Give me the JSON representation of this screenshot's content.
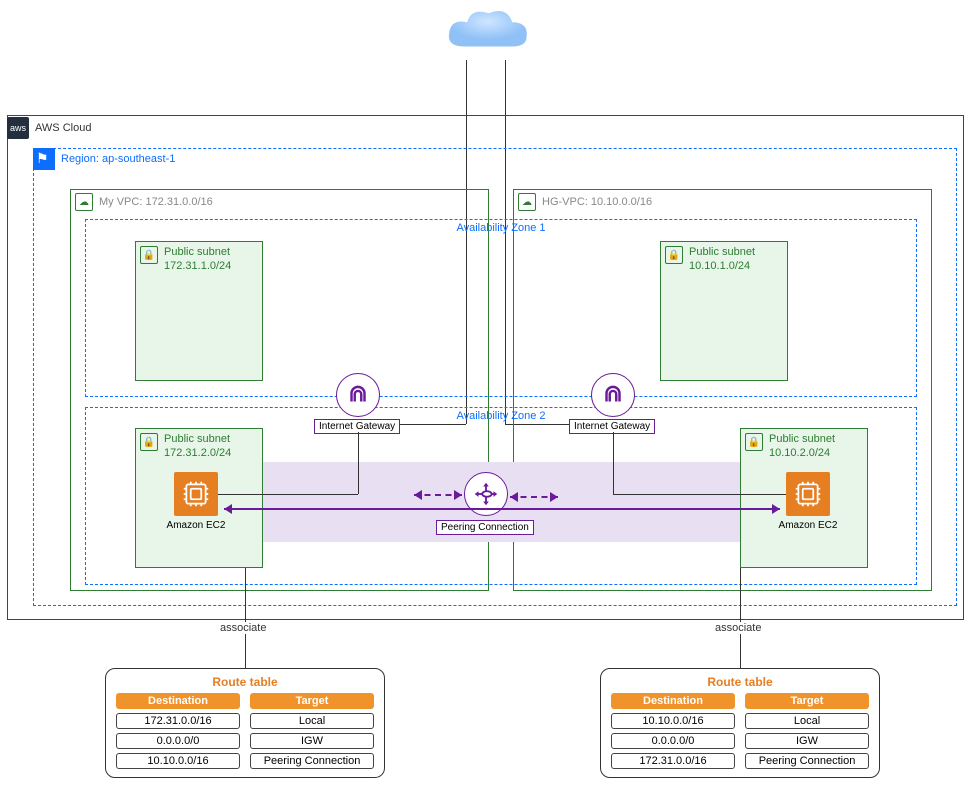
{
  "aws": {
    "label": "AWS Cloud"
  },
  "region": {
    "label": "Region: ap-southeast-1"
  },
  "vpc_left": {
    "label": "My VPC: 172.31.0.0/16"
  },
  "vpc_right": {
    "label": "HG-VPC: 10.10.0.0/16"
  },
  "az": {
    "zone1": "Availability Zone 1",
    "zone2": "Availability Zone 2"
  },
  "subnet_label": "Public subnet",
  "subnets": {
    "l1": "172.31.1.0/24",
    "l2": "172.31.2.0/24",
    "r1": "10.10.1.0/24",
    "r2": "10.10.2.0/24"
  },
  "igw_label": "Internet Gateway",
  "peer_label": "Peering Connection",
  "ec2_label": "Amazon  EC2",
  "associate": "associate",
  "route_table": {
    "title": "Route table",
    "headers": {
      "dest": "Destination",
      "target": "Target"
    },
    "left": {
      "rows": [
        {
          "dest": "172.31.0.0/16",
          "target": "Local"
        },
        {
          "dest": "0.0.0.0/0",
          "target": "IGW"
        },
        {
          "dest": "10.10.0.0/16",
          "target": "Peering Connection"
        }
      ]
    },
    "right": {
      "rows": [
        {
          "dest": "10.10.0.0/16",
          "target": "Local"
        },
        {
          "dest": "0.0.0.0/0",
          "target": "IGW"
        },
        {
          "dest": "172.31.0.0/16",
          "target": "Peering Connection"
        }
      ]
    }
  }
}
